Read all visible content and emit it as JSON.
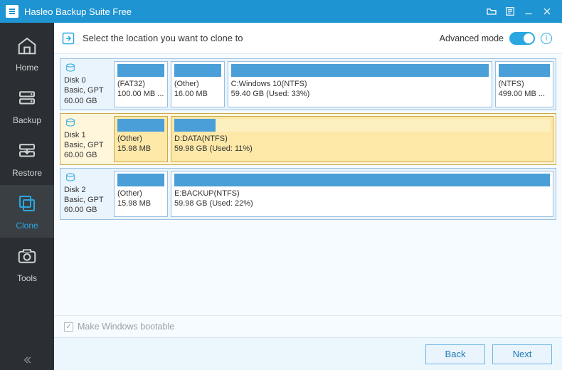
{
  "titlebar": {
    "title": "Hasleo Backup Suite Free"
  },
  "sidebar": {
    "items": [
      {
        "label": "Home"
      },
      {
        "label": "Backup"
      },
      {
        "label": "Restore"
      },
      {
        "label": "Clone"
      },
      {
        "label": "Tools"
      }
    ],
    "active_index": 3
  },
  "header": {
    "lead_text": "Select the location you want to clone to",
    "advanced_label": "Advanced mode",
    "advanced_on": true
  },
  "disks": [
    {
      "id": "Disk 0",
      "subtype": "Basic, GPT",
      "size": "60.00 GB",
      "selected": false,
      "partitions": [
        {
          "name": "(FAT32)",
          "sub": "100.00 MB ...",
          "flex": 1.0,
          "fill_pct": 100
        },
        {
          "name": "(Other)",
          "sub": "16.00 MB",
          "flex": 1.0,
          "fill_pct": 100
        },
        {
          "name": "C:Windows 10(NTFS)",
          "sub": "59.40 GB (Used: 33%)",
          "flex": 5.5,
          "fill_pct": 100
        },
        {
          "name": "(NTFS)",
          "sub": "499.00 MB ...",
          "flex": 1.1,
          "fill_pct": 100
        }
      ]
    },
    {
      "id": "Disk 1",
      "subtype": "Basic, GPT",
      "size": "60.00 GB",
      "selected": true,
      "partitions": [
        {
          "name": "(Other)",
          "sub": "15.98 MB",
          "flex": 1.0,
          "fill_pct": 100
        },
        {
          "name": "D:DATA(NTFS)",
          "sub": "59.98 GB (Used: 11%)",
          "flex": 8.0,
          "fill_pct": 11
        }
      ]
    },
    {
      "id": "Disk 2",
      "subtype": "Basic, GPT",
      "size": "60.00 GB",
      "selected": false,
      "partitions": [
        {
          "name": "(Other)",
          "sub": "15.98 MB",
          "flex": 1.0,
          "fill_pct": 100
        },
        {
          "name": "E:BACKUP(NTFS)",
          "sub": "59.98 GB (Used: 22%)",
          "flex": 8.0,
          "fill_pct": 100
        }
      ]
    }
  ],
  "options": {
    "make_bootable_label": "Make Windows bootable",
    "make_bootable_checked": true,
    "make_bootable_enabled": false
  },
  "footer": {
    "back": "Back",
    "next": "Next"
  }
}
